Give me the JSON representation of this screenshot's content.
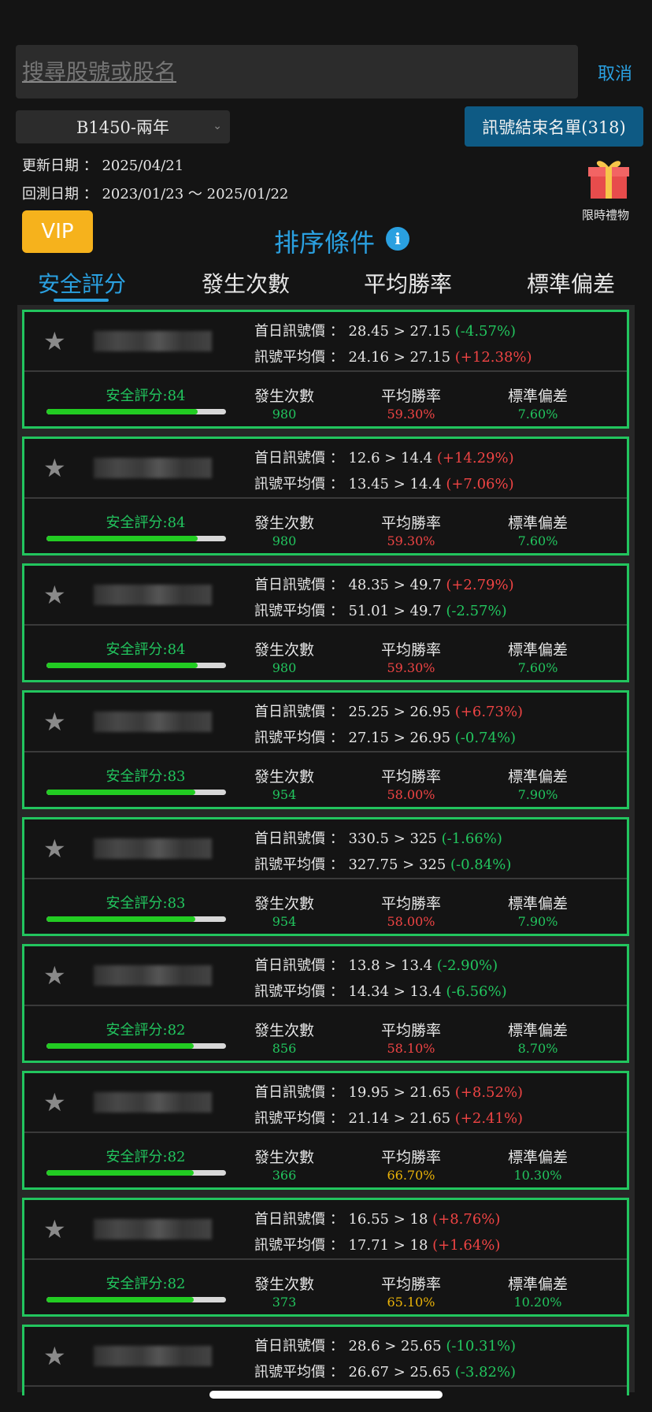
{
  "search": {
    "placeholder": "搜尋股號或股名",
    "cancel_label": "取消"
  },
  "filter": {
    "selected": "B1450-兩年",
    "end_list_label": "訊號結束名單(318)"
  },
  "dates": {
    "update": "更新日期 ： 2025/04/21",
    "backtest": "回測日期 ： 2023/01/23 ～ 2025/01/22"
  },
  "gift": {
    "label": "限時禮物"
  },
  "vip_label": "VIP",
  "sort": {
    "title": "排序條件",
    "info_glyph": "i"
  },
  "tabs": [
    {
      "label": "安全評分",
      "active": true
    },
    {
      "label": "發生次數",
      "active": false
    },
    {
      "label": "平均勝率",
      "active": false
    },
    {
      "label": "標準偏差",
      "active": false
    }
  ],
  "stat_labels": {
    "count": "發生次數",
    "win": "平均勝率",
    "std": "標準偏差"
  },
  "cards": [
    {
      "first": "首日訊號價 ： 28.45 > 27.15 ",
      "first_pct": "(-4.57%)",
      "first_dir": "neg",
      "avg": "訊號平均價 ： 24.16 > 27.15 ",
      "avg_pct": "(+12.38%)",
      "avg_dir": "pos",
      "score": "安全評分:84",
      "score_value": 84,
      "count": "980",
      "win": "59.30%",
      "win_color": "red",
      "std": "7.60%",
      "std_color": "green"
    },
    {
      "first": "首日訊號價 ： 12.6 > 14.4 ",
      "first_pct": "(+14.29%)",
      "first_dir": "pos",
      "avg": "訊號平均價 ： 13.45 > 14.4 ",
      "avg_pct": "(+7.06%)",
      "avg_dir": "pos",
      "score": "安全評分:84",
      "score_value": 84,
      "count": "980",
      "win": "59.30%",
      "win_color": "red",
      "std": "7.60%",
      "std_color": "green"
    },
    {
      "first": "首日訊號價 ： 48.35 > 49.7 ",
      "first_pct": "(+2.79%)",
      "first_dir": "pos",
      "avg": "訊號平均價 ： 51.01 > 49.7 ",
      "avg_pct": "(-2.57%)",
      "avg_dir": "neg",
      "score": "安全評分:84",
      "score_value": 84,
      "count": "980",
      "win": "59.30%",
      "win_color": "red",
      "std": "7.60%",
      "std_color": "green"
    },
    {
      "first": "首日訊號價 ： 25.25 > 26.95 ",
      "first_pct": "(+6.73%)",
      "first_dir": "pos",
      "avg": "訊號平均價 ： 27.15 > 26.95 ",
      "avg_pct": "(-0.74%)",
      "avg_dir": "neg",
      "score": "安全評分:83",
      "score_value": 83,
      "count": "954",
      "win": "58.00%",
      "win_color": "red",
      "std": "7.90%",
      "std_color": "green"
    },
    {
      "first": "首日訊號價 ： 330.5 > 325 ",
      "first_pct": "(-1.66%)",
      "first_dir": "neg",
      "avg": "訊號平均價 ： 327.75 > 325 ",
      "avg_pct": "(-0.84%)",
      "avg_dir": "neg",
      "score": "安全評分:83",
      "score_value": 83,
      "count": "954",
      "win": "58.00%",
      "win_color": "red",
      "std": "7.90%",
      "std_color": "green"
    },
    {
      "first": "首日訊號價 ： 13.8 > 13.4 ",
      "first_pct": "(-2.90%)",
      "first_dir": "neg",
      "avg": "訊號平均價 ： 14.34 > 13.4 ",
      "avg_pct": "(-6.56%)",
      "avg_dir": "neg",
      "score": "安全評分:82",
      "score_value": 82,
      "count": "856",
      "win": "58.10%",
      "win_color": "red",
      "std": "8.70%",
      "std_color": "green"
    },
    {
      "first": "首日訊號價 ： 19.95 > 21.65 ",
      "first_pct": "(+8.52%)",
      "first_dir": "pos",
      "avg": "訊號平均價 ： 21.14 > 21.65 ",
      "avg_pct": "(+2.41%)",
      "avg_dir": "pos",
      "score": "安全評分:82",
      "score_value": 82,
      "count": "366",
      "win": "66.70%",
      "win_color": "yellow",
      "std": "10.30%",
      "std_color": "green"
    },
    {
      "first": "首日訊號價 ： 16.55 > 18 ",
      "first_pct": "(+8.76%)",
      "first_dir": "pos",
      "avg": "訊號平均價 ： 17.71 > 18 ",
      "avg_pct": "(+1.64%)",
      "avg_dir": "pos",
      "score": "安全評分:82",
      "score_value": 82,
      "count": "373",
      "win": "65.10%",
      "win_color": "yellow",
      "std": "10.20%",
      "std_color": "green"
    },
    {
      "first": "首日訊號價 ： 28.6 > 25.65 ",
      "first_pct": "(-10.31%)",
      "first_dir": "neg",
      "avg": "訊號平均價 ： 26.67 > 25.65 ",
      "avg_pct": "(-3.82%)",
      "avg_dir": "neg",
      "score": "",
      "score_value": null,
      "count": "",
      "win": "",
      "win_color": "green",
      "std": "",
      "std_color": "green"
    }
  ]
}
